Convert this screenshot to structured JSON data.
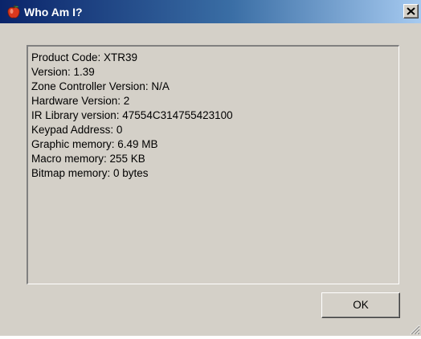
{
  "window": {
    "title": "Who Am I?",
    "close_symbol": "×",
    "icons": {
      "app": "apple-icon",
      "close": "close-icon",
      "resize": "resize-grip-icon"
    }
  },
  "info": {
    "lines": [
      "Product Code: XTR39",
      "Version: 1.39",
      "Zone Controller Version: N/A",
      "Hardware Version: 2",
      "IR Library version: 47554C314755423100",
      "Keypad Address: 0",
      "Graphic memory: 6.49 MB",
      "Macro memory: 255 KB",
      "Bitmap memory: 0 bytes"
    ]
  },
  "buttons": {
    "ok_label": "OK"
  },
  "colors": {
    "titlebar_start": "#0a246a",
    "titlebar_end": "#a6caf0",
    "dialog_face": "#d4d0c8"
  }
}
